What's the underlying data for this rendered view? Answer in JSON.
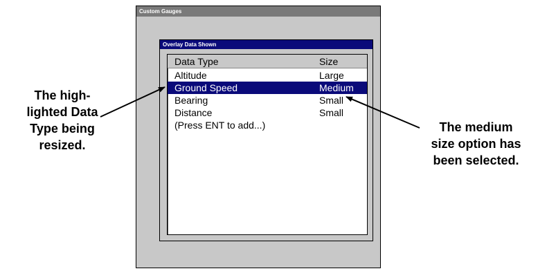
{
  "screen": {
    "title": "Custom Gauges"
  },
  "dialog": {
    "title": "Overlay Data Shown",
    "columns": {
      "type_label": "Data Type",
      "size_label": "Size"
    },
    "rows": [
      {
        "type": "Altitude",
        "size": "Large",
        "selected": false
      },
      {
        "type": "Ground Speed",
        "size": "Medium",
        "selected": true
      },
      {
        "type": "Bearing",
        "size": "Small",
        "selected": false
      },
      {
        "type": "Distance",
        "size": "Small",
        "selected": false
      },
      {
        "type": "(Press ENT to add...)",
        "size": "",
        "selected": false
      }
    ]
  },
  "annotations": {
    "left_lines": [
      "The high-",
      "lighted Data",
      "Type being",
      "resized."
    ],
    "right_lines": [
      "The medium",
      "size option has",
      "been selected."
    ]
  },
  "colors": {
    "highlight": "#0a0a7a",
    "panel_gray": "#c8c8c8",
    "titlebar_gray": "#7a7a7a"
  }
}
